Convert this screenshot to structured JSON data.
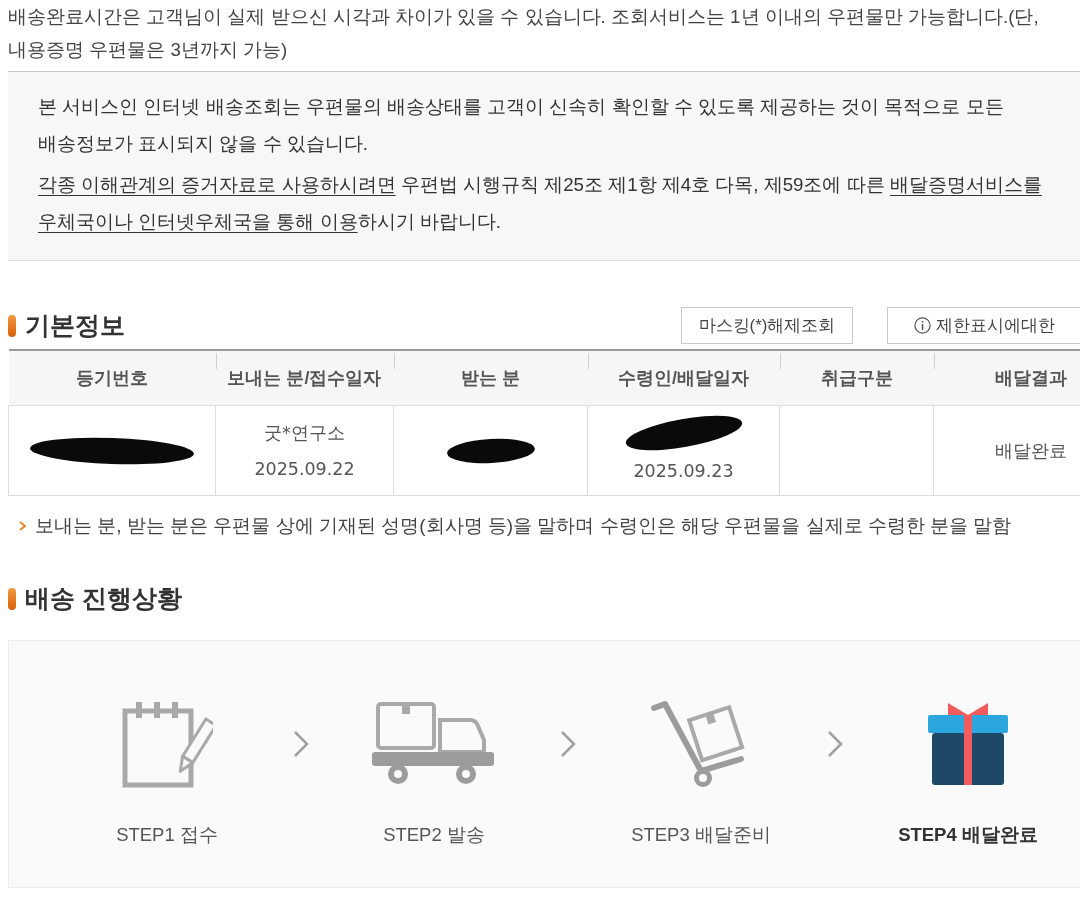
{
  "top_note": {
    "text": "배송완료시간은 고객님이 실제 받으신 시각과 차이가 있을 수 있습니다. 조회서비스는 1년 이내의 우편물만 가능합니다.(단, 내용증명 우편물은 3년까지 가능)"
  },
  "disclaimer": {
    "paragraphs": [
      [
        {
          "text": "본 서비스인 인터넷 배송조회는 우편물의 배송상태를 고객이 신속히 확인할 수 있도록 제공하는 것이 목적으로 모든 배송정보가 표시되지 않을 수 있습니다.",
          "underlined": false
        }
      ],
      [
        {
          "text": "각종 이해관계의 증거자료로 사용하시려면",
          "underlined": true
        },
        {
          "text": " 우편법 시행규칙 제25조 제1항 제4호 다목, 제59조에 따른 ",
          "underlined": false
        },
        {
          "text": "배달증명서비스를 우체국이나 인터넷우체국을 통해 이용",
          "underlined": true
        },
        {
          "text": "하시기 바랍니다.",
          "underlined": false
        }
      ]
    ]
  },
  "basic_info": {
    "title": "기본정보",
    "buttons": [
      {
        "label": "마스킹(*)해제조회",
        "kind": "plain"
      },
      {
        "label": "제한표시에대한",
        "kind": "info"
      }
    ],
    "table": {
      "columns": [
        "등기번호",
        "보내는 분/접수일자",
        "받는 분",
        "수령인/배달일자",
        "취급구분",
        "배달결과"
      ],
      "rows": [
        {
          "cells": [
            {
              "redacted": true
            },
            {
              "redacted": false,
              "lines": [
                "굿*연구소",
                "2025.09.22"
              ]
            },
            {
              "redacted": true
            },
            {
              "redacted": true,
              "lines": [
                "2025.09.23"
              ]
            },
            {
              "redacted": false
            },
            {
              "redacted": false,
              "lines": [
                "배달완료"
              ]
            }
          ]
        }
      ]
    },
    "note": "보내는 분, 받는 분은 우편물 상에 기재된 성명(회사명 등)을 말하며 수령인은 해당 우편물을 실제로 수령한 분을 말함"
  },
  "progress": {
    "title": "배송 진행상황",
    "steps": [
      {
        "label": "STEP1 접수",
        "current": false
      },
      {
        "label": "STEP2 발송",
        "current": false
      },
      {
        "label": "STEP3 배달준비",
        "current": false
      },
      {
        "label": "STEP4 배달완료",
        "current": true
      }
    ]
  }
}
